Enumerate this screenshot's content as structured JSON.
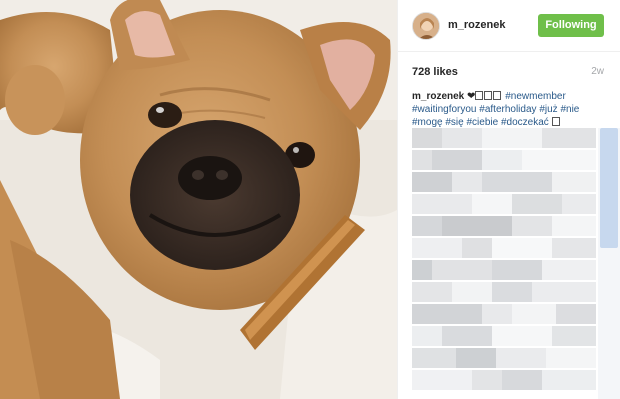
{
  "post": {
    "photo_icon": "dog-photo",
    "author": {
      "username": "m_rozenek",
      "avatar_icon": "profile-avatar"
    },
    "follow_button": {
      "label": "Following",
      "color": "#6fbf4a"
    },
    "likes": "728 likes",
    "time": "2w",
    "caption": {
      "username": "m_rozenek",
      "heart": "❤",
      "tags": [
        "#newmember",
        "#waitingforyou",
        "#afterholiday",
        "#już",
        "#nie",
        "#mogę",
        "#się",
        "#ciebie",
        "#doczekać"
      ]
    },
    "comments_state": "pixelated / censored"
  },
  "colors": {
    "hashtag": "#2a5a8a",
    "muted": "#a5a7aa",
    "scroll_thumb": "#c7d8ee"
  }
}
